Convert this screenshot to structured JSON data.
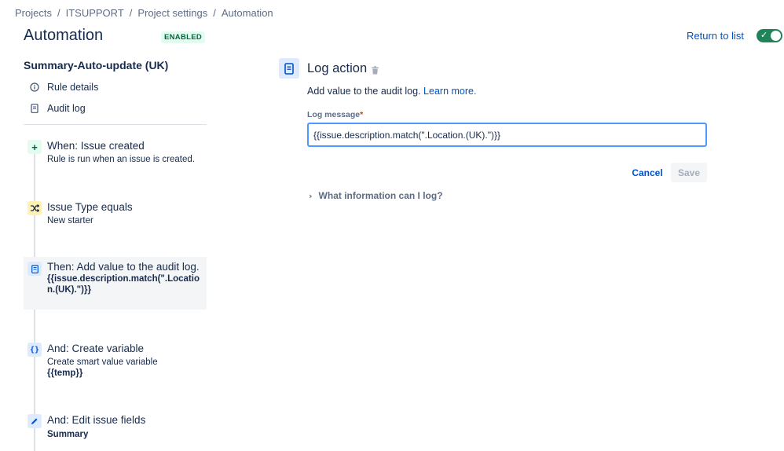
{
  "breadcrumb": {
    "items": [
      "Projects",
      "ITSUPPORT",
      "Project settings",
      "Automation"
    ],
    "separator": "/"
  },
  "header": {
    "title": "Automation",
    "status": "ENABLED",
    "return_link": "Return to list",
    "toggle_on": true
  },
  "sidebar": {
    "rule_name": "Summary-Auto-update (UK)",
    "links": [
      {
        "label": "Rule details",
        "icon": "info-icon"
      },
      {
        "label": "Audit log",
        "icon": "document-icon"
      }
    ]
  },
  "steps": [
    {
      "title": "When: Issue created",
      "sub": "Rule is run when an issue is created.",
      "bold": "",
      "icon": "plus-icon",
      "icon_color": "#e3fcef"
    },
    {
      "title": "Issue Type equals",
      "sub": "New starter",
      "bold": "",
      "icon": "shuffle-icon",
      "icon_color": "#fff0b3"
    },
    {
      "title": "Then: Add value to the audit log.",
      "sub": "",
      "bold": "{{issue.description.match(\".Location.(UK).\")}}",
      "icon": "document-icon",
      "icon_color": "#deebff",
      "selected": true
    },
    {
      "title": "And: Create variable",
      "sub": "Create smart value variable",
      "bold": "{{temp}}",
      "icon": "braces-icon",
      "icon_color": "#deebff"
    },
    {
      "title": "And: Edit issue fields",
      "sub": "",
      "bold": "Summary",
      "icon": "pencil-icon",
      "icon_color": "#deebff"
    }
  ],
  "panel": {
    "title": "Log action",
    "description": "Add value to the audit log.",
    "learn_more": "Learn more.",
    "field_label": "Log message",
    "required_marker": "*",
    "field_value": "{{issue.description.match(\".Location.(UK).\")}}",
    "cancel_label": "Cancel",
    "save_label": "Save",
    "expander_label": "What information can I log?"
  }
}
